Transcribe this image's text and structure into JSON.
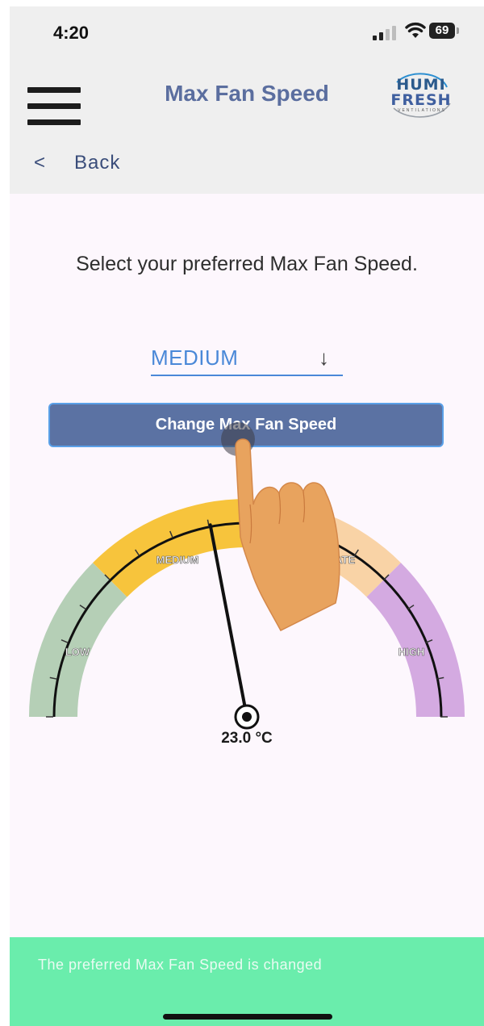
{
  "status_bar": {
    "time": "4:20",
    "battery": "69"
  },
  "header": {
    "title": "Max Fan Speed",
    "logo": {
      "line1": "HUMI",
      "line2": "FRESH",
      "line3": "VENTILATIONS"
    }
  },
  "nav": {
    "back_chevron": "<",
    "back_label": "Back"
  },
  "main": {
    "instruction": "Select your preferred Max Fan Speed.",
    "dropdown": {
      "selected": "MEDIUM",
      "arrow": "↓"
    },
    "button_label": "Change Max Fan Speed"
  },
  "gauge": {
    "segments": [
      {
        "label": "LOW",
        "color": "#b5cfb6"
      },
      {
        "label": "MEDIUM",
        "color": "#f7c43c"
      },
      {
        "label": "INTERMEDIATE",
        "color": "#f9d3a6"
      },
      {
        "label": "HIGH",
        "color": "#d4aae1"
      }
    ],
    "needle_value_fraction": 0.44,
    "temperature": "23.0 °C"
  },
  "toast": {
    "message": "The preferred Max Fan Speed is changed"
  },
  "colors": {
    "accent": "#5b72a3",
    "title": "#5b6e9f",
    "link": "#4a88d8",
    "toast": "#6aedac",
    "hand": "#e8a35e"
  }
}
